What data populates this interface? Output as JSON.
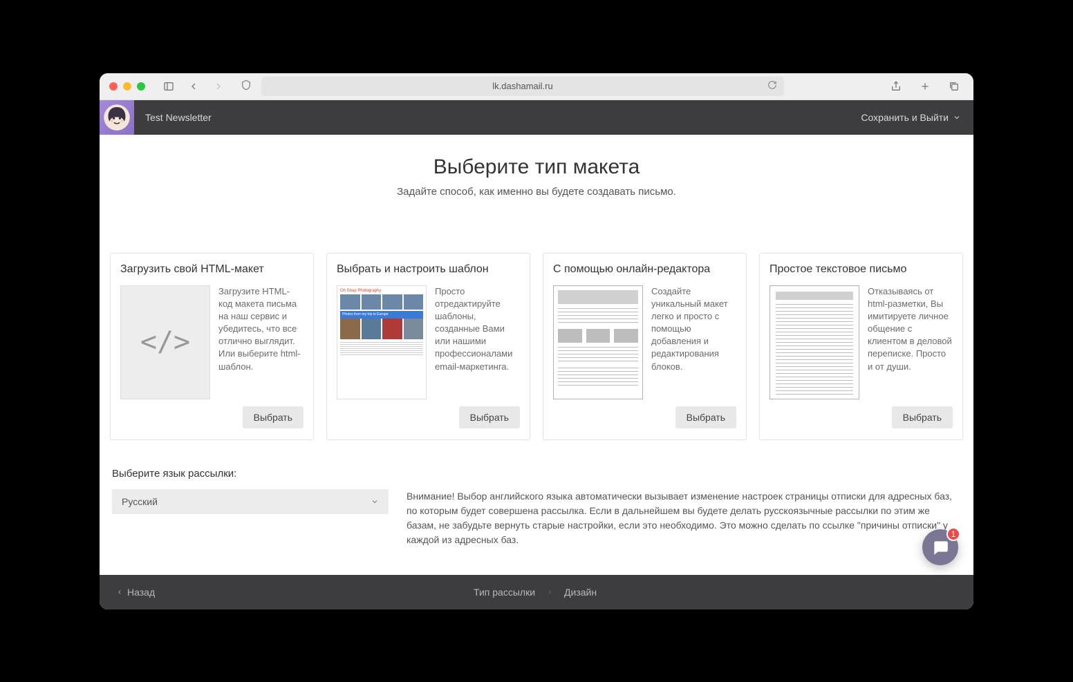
{
  "browser": {
    "url": "lk.dashamail.ru"
  },
  "header": {
    "title": "Test Newsletter",
    "save_exit": "Сохранить и Выйти"
  },
  "page": {
    "title": "Выберите тип макета",
    "subtitle": "Задайте способ, как именно вы будете создавать письмо."
  },
  "cards": [
    {
      "title": "Загрузить свой HTML-макет",
      "desc": "Загрузите HTML-код макета письма на наш сервис и убедитесь, что все отлично выглядит. Или выберите html-шаблон.",
      "button": "Выбрать"
    },
    {
      "title": "Выбрать и настроить шаблон",
      "desc": "Просто отредактируйте шаблоны, созданные Вами или нашими профессионалами email-маркетинга.",
      "button": "Выбрать",
      "thumb_brand": "Oh Snap Photography",
      "thumb_banner": "Photos from my trip to Europe"
    },
    {
      "title": "С помощью онлайн-редактора",
      "desc": "Создайте уникальный макет легко и просто с помощью добавления и редактирования блоков.",
      "button": "Выбрать"
    },
    {
      "title": "Простое текстовое письмо",
      "desc": "Отказываясь от html-разметки, Вы имитируете личное общение с клиентом в деловой переписке. Просто и от души.",
      "button": "Выбрать"
    }
  ],
  "language": {
    "label": "Выберите язык рассылки:",
    "selected": "Русский",
    "note": "Внимание! Выбор английского языка автоматически вызывает изменение настроек страницы отписки для адресных баз, по которым будет совершена рассылка. Если в дальнейшем вы будете делать русскоязычные рассылки по этим же базам, не забудьте вернуть старые настройки, если это необходимо. Это можно сделать по ссылке \"причины отписки\" у каждой из адресных баз."
  },
  "footer": {
    "back": "Назад",
    "steps": [
      "Тип рассылки",
      "Дизайн"
    ]
  },
  "chat": {
    "badge": "1"
  }
}
